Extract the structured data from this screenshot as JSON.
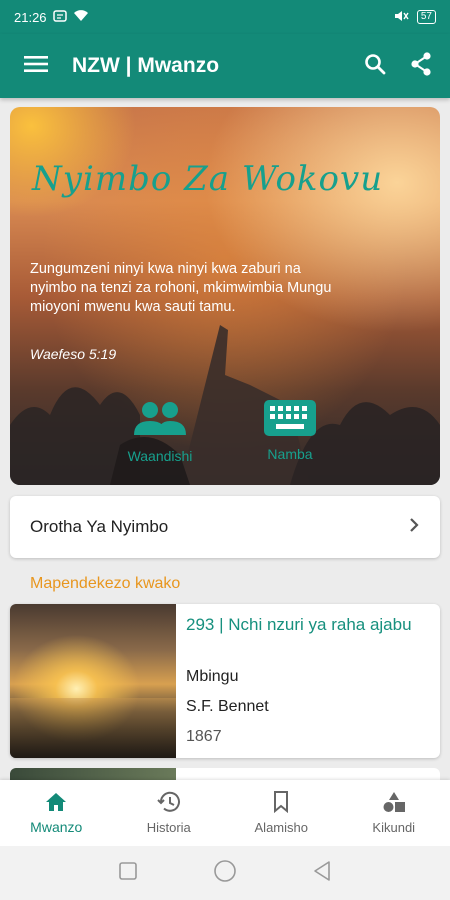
{
  "status_bar": {
    "time": "21:26",
    "battery": "57"
  },
  "app_bar": {
    "title": "NZW | Mwanzo"
  },
  "hero": {
    "title": "Nyimbo Za Wokovu",
    "quote": "Zungumzeni ninyi kwa ninyi kwa zaburi na nyimbo na tenzi za rohoni, mkimwimbia Mungu mioyoni mwenu kwa sauti tamu.",
    "reference": "Waefeso 5:19",
    "buttons": [
      {
        "label": "Waandishi"
      },
      {
        "label": "Namba"
      }
    ]
  },
  "song_list_card": {
    "label": "Orotha Ya Nyimbo"
  },
  "recommendations": {
    "title": "Mapendekezo kwako",
    "items": [
      {
        "title": "293 | Nchi nzuri ya raha ajabu",
        "category": "Mbingu",
        "author": "S.F. Bennet",
        "year": "1867"
      }
    ]
  },
  "bottom_nav": {
    "items": [
      {
        "label": "Mwanzo",
        "active": true
      },
      {
        "label": "Historia",
        "active": false
      },
      {
        "label": "Alamisho",
        "active": false
      },
      {
        "label": "Kikundi",
        "active": false
      }
    ]
  },
  "colors": {
    "primary": "#138a78",
    "accent": "#e8961e",
    "teal_text": "#17a08d"
  }
}
